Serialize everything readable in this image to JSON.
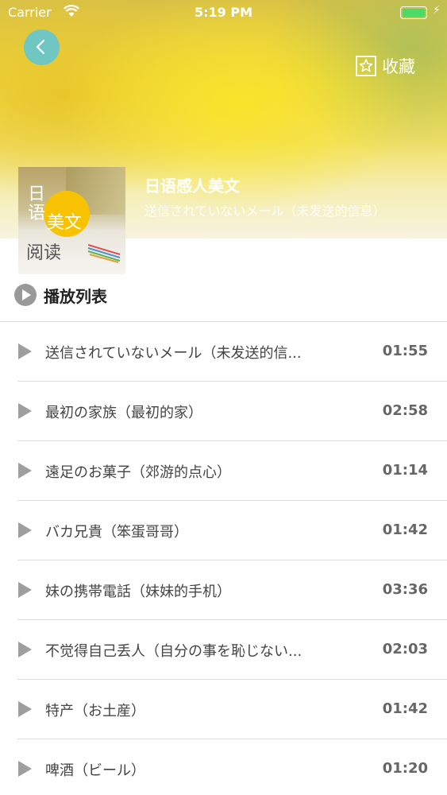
{
  "status": {
    "carrier": "Carrier",
    "time": "5:19 PM"
  },
  "nav": {
    "favorite_label": "收藏"
  },
  "album": {
    "title": "日语感人美文",
    "subtitle": "送信されていないメール（未发送的信息）",
    "cover_text": [
      "日",
      "语",
      "美文",
      "阅读"
    ]
  },
  "playlist": {
    "label": "播放列表"
  },
  "tracks": [
    {
      "title": "送信されていないメール（未发送的信...",
      "duration": "01:55"
    },
    {
      "title": "最初の家族（最初的家）",
      "duration": "02:58"
    },
    {
      "title": "遠足のお菓子（郊游的点心）",
      "duration": "01:14"
    },
    {
      "title": "バカ兄貴（笨蛋哥哥）",
      "duration": "01:42"
    },
    {
      "title": "妹の携帯電話（妹妹的手机）",
      "duration": "03:36"
    },
    {
      "title": "不觉得自己丢人（自分の事を恥じない...",
      "duration": "02:03"
    },
    {
      "title": "特产（お土産）",
      "duration": "01:42"
    },
    {
      "title": "啤酒（ビール）",
      "duration": "01:20"
    }
  ],
  "icons": [
    "wifi-icon",
    "battery-icon",
    "back-icon",
    "star-icon",
    "play-icon"
  ],
  "colors": {
    "accent": "#6fc6c3",
    "battery": "#4cd964",
    "cover_circle": "#f7c300"
  }
}
